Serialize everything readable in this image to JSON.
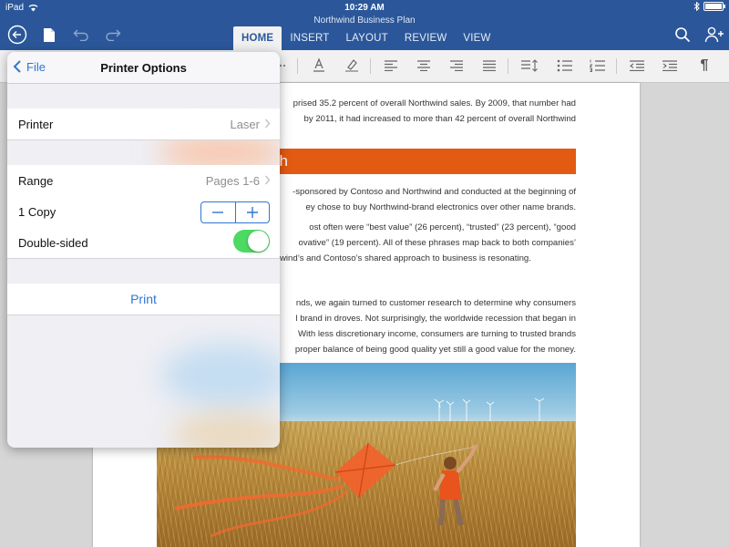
{
  "status": {
    "device": "iPad",
    "time": "10:29 AM"
  },
  "document": {
    "title": "Northwind Business Plan"
  },
  "ribbon": {
    "tabs": [
      {
        "label": "HOME"
      },
      {
        "label": "INSERT"
      },
      {
        "label": "LAYOUT"
      },
      {
        "label": "REVIEW"
      },
      {
        "label": "VIEW"
      }
    ]
  },
  "icons": {
    "back": "back-circle-icon",
    "file": "document-icon",
    "undo": "undo-icon",
    "redo": "redo-icon",
    "search": "search-icon",
    "share": "add-person-icon"
  },
  "popover": {
    "back_label": "File",
    "title": "Printer Options",
    "printer": {
      "label": "Printer",
      "value": "Laser"
    },
    "range": {
      "label": "Range",
      "value": "Pages 1-6"
    },
    "copies": {
      "label": "1 Copy"
    },
    "double_sided": {
      "label": "Double-sided",
      "on": true
    },
    "print_label": "Print"
  },
  "page": {
    "para1": [
      "prised 35.2 percent of overall Northwind sales. By 2009, that number had",
      "by 2011, it had increased to more than 42 percent of overall Northwind"
    ],
    "heading": "ch",
    "para2": [
      "-sponsored by Contoso and Northwind and conducted at the beginning of",
      "ey chose to buy Northwind-brand electronics over other name brands."
    ],
    "para3": [
      "ost often were “best value” (26 percent), “trusted” (23 percent), “good",
      "ovative” (19 percent). All of these phrases map back to both companies’",
      "wind’s and Contoso’s shared approach to business is resonating."
    ],
    "para4": [
      "nds, we again turned to customer research to determine why consumers",
      "l brand in droves. Not surprisingly, the worldwide recession that began in",
      "With less discretionary income, consumers are turning to trusted brands",
      "proper balance of being good quality yet still a good value for the money."
    ]
  },
  "colors": {
    "header": "#2b579a",
    "accent": "#2f77d1",
    "heading_bar": "#e35a12",
    "toggle_on": "#4cd964"
  }
}
